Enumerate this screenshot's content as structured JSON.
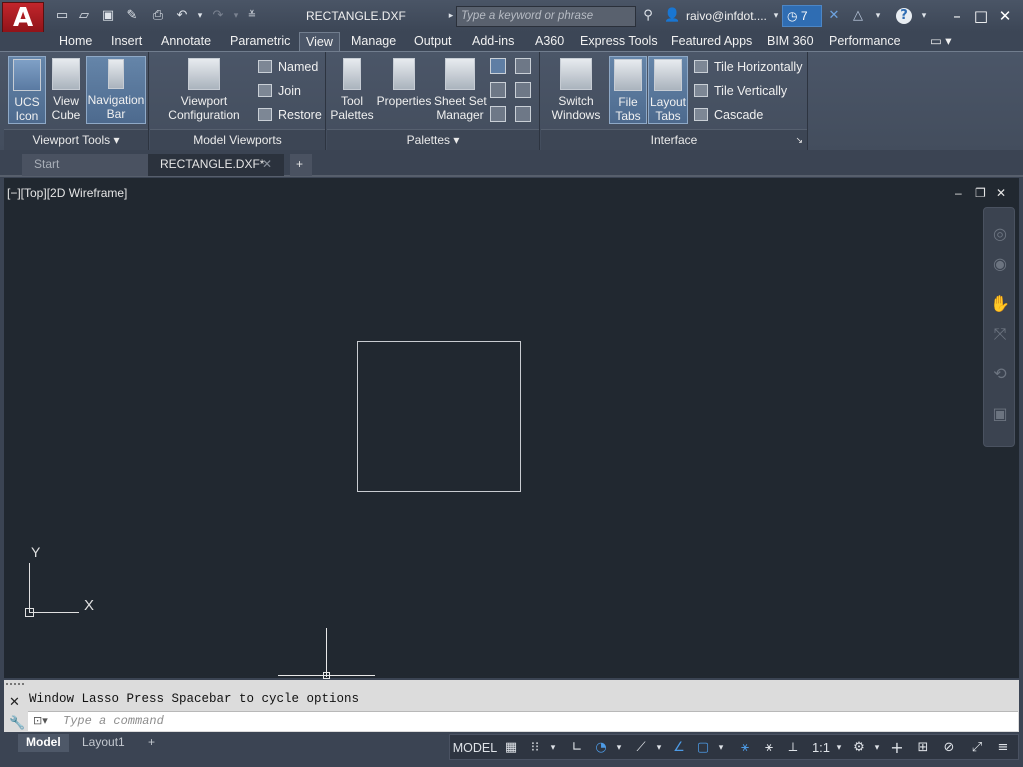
{
  "title_bar": {
    "app_button": "A",
    "document_title": "RECTANGLE.DXF",
    "search_placeholder": "Type a keyword or phrase",
    "user": "raivo@infdot....",
    "clock_count": "7"
  },
  "ribbon_tabs": [
    "Home",
    "Insert",
    "Annotate",
    "Parametric",
    "View",
    "Manage",
    "Output",
    "Add-ins",
    "A360",
    "Express Tools",
    "Featured Apps",
    "BIM 360",
    "Performance"
  ],
  "active_tab": "View",
  "panels": {
    "viewport_tools": {
      "title": "Viewport Tools",
      "ucs_icon": "UCS\nIcon",
      "view_cube": "View\nCube",
      "navigation_bar": "Navigation\nBar"
    },
    "model_viewports": {
      "title": "Model Viewports",
      "viewport_configuration": "Viewport\nConfiguration",
      "named": "Named",
      "join": "Join",
      "restore": "Restore"
    },
    "palettes": {
      "title": "Palettes",
      "tool_palettes": "Tool\nPalettes",
      "properties": "Properties",
      "sheet_set_manager": "Sheet Set\nManager"
    },
    "interface": {
      "title": "Interface",
      "switch_windows": "Switch\nWindows",
      "file_tabs": "File\nTabs",
      "layout_tabs": "Layout\nTabs",
      "tile_horizontally": "Tile Horizontally",
      "tile_vertically": "Tile Vertically",
      "cascade": "Cascade"
    }
  },
  "file_tabs": {
    "start": "Start",
    "active": "RECTANGLE.DXF*",
    "add": "+"
  },
  "viewport": {
    "label": "[−][Top][2D Wireframe]",
    "ucs_y": "Y",
    "ucs_x": "X"
  },
  "command_line": {
    "history": "Window Lasso  Press Spacebar to cycle options",
    "placeholder": "Type a command"
  },
  "layout_tabs": {
    "model": "Model",
    "layout1": "Layout1",
    "add": "+"
  },
  "status": {
    "model": "MODEL",
    "scale": "1:1"
  },
  "colors": {
    "canvas": "#212830",
    "ribbon": "#4b5668",
    "accent": "#2f6db3",
    "app_red": "#c2262c"
  }
}
